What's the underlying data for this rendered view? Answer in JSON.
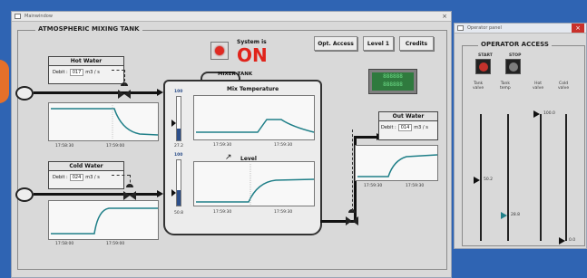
{
  "colors": {
    "desktop": "#2f64b3",
    "on_text": "#e0241b",
    "trend_line": "#1f7f88",
    "level_fill": "#2c4f8a",
    "green_display": "#3a8a4a"
  },
  "main_window": {
    "title": "Mainwindow",
    "panel_title": "ATMOSPHERIC MIXING TANK",
    "close_glyph": "×"
  },
  "system": {
    "label": "System is",
    "state": "ON",
    "button_icon": "power-button-icon"
  },
  "toolbar": {
    "opt_access": "Opt. Access",
    "level1": "Level 1",
    "credits": "Credits"
  },
  "hot_water": {
    "title": "Hot Water",
    "label": "Debit :",
    "value": "017",
    "unit": "m3 / s",
    "times": [
      "17:58:30",
      "17:59:00"
    ]
  },
  "cold_water": {
    "title": "Cold Water",
    "label": "Debit :",
    "value": "024",
    "unit": "m3 / s",
    "times": [
      "17:58:00",
      "17:59:00"
    ]
  },
  "tank": {
    "title": "MIXER TANK"
  },
  "mix_temp": {
    "title": "Mix Temperature",
    "scale_top": "100",
    "scale_bottom": "27.2",
    "times": [
      "17:59:30",
      "17:59:30"
    ]
  },
  "level": {
    "title": "Level",
    "scale_top": "100",
    "scale_bottom": "50.8",
    "times": [
      "17:59:30",
      "17:59:30"
    ]
  },
  "out_water": {
    "title": "Out Water",
    "label": "Debit :",
    "value": "014",
    "unit": "m3 / s",
    "times": [
      "17:59:30",
      "17:59:30"
    ]
  },
  "display": {
    "text": "888888\n888888"
  },
  "operator_window": {
    "title": "Operator panel",
    "panel_title": "OPERATOR ACCESS",
    "start": "START",
    "stop": "STOP",
    "close_glyph": "×",
    "sliders": [
      {
        "label": "Tank\nvalve",
        "value": "50.2",
        "value_fraction": 0.52
      },
      {
        "label": "Tank\ntemp",
        "value": "28.8",
        "value_fraction": 0.8
      },
      {
        "label": "Hot\nvalve",
        "value": "100.0",
        "value_fraction": 0.0
      },
      {
        "label": "Cold\nvalve",
        "value": "0.0",
        "value_fraction": 1.0
      }
    ]
  }
}
